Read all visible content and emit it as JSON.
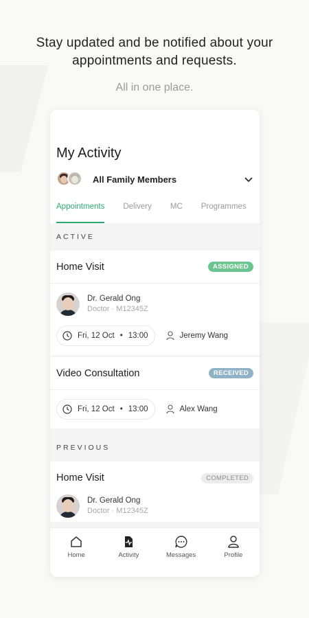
{
  "intro": {
    "headline_line1": "Stay updated and be notified about your",
    "headline_line2": "appointments and requests.",
    "subline": "All in one place."
  },
  "screen": {
    "title": "My Activity",
    "family_selector": {
      "label": "All Family Members",
      "icon": "chevron-down-icon"
    },
    "tabs": [
      {
        "label": "Appointments",
        "active": true
      },
      {
        "label": "Delivery",
        "active": false
      },
      {
        "label": "MC",
        "active": false
      },
      {
        "label": "Programmes",
        "active": false
      }
    ],
    "sections": {
      "active": "ACTIVE",
      "previous": "PREVIOUS"
    },
    "active_cards": [
      {
        "title": "Home Visit",
        "badge": "ASSIGNED",
        "doctor_name": "Dr. Gerald Ong",
        "doctor_role": "Doctor",
        "doctor_id": "M12345Z",
        "date": "Fri, 12 Oct",
        "time": "13:00",
        "patient": "Jeremy Wang"
      },
      {
        "title": "Video Consultation",
        "badge": "RECEIVED",
        "date": "Fri, 12 Oct",
        "time": "13:00",
        "patient": "Alex Wang"
      }
    ],
    "previous_cards": [
      {
        "title": "Home Visit",
        "badge": "COMPLETED",
        "doctor_name": "Dr. Gerald Ong",
        "doctor_role": "Doctor",
        "doctor_id": "M12345Z"
      }
    ],
    "bottom_nav": [
      {
        "label": "Home",
        "icon": "home-icon"
      },
      {
        "label": "Activity",
        "icon": "activity-icon"
      },
      {
        "label": "Messages",
        "icon": "messages-icon"
      },
      {
        "label": "Profile",
        "icon": "profile-icon"
      }
    ]
  },
  "colors": {
    "accent_green": "#2ea973",
    "badge_assigned": "#6cc58e",
    "badge_received": "#8fb2c7",
    "badge_completed": "#ececec"
  }
}
